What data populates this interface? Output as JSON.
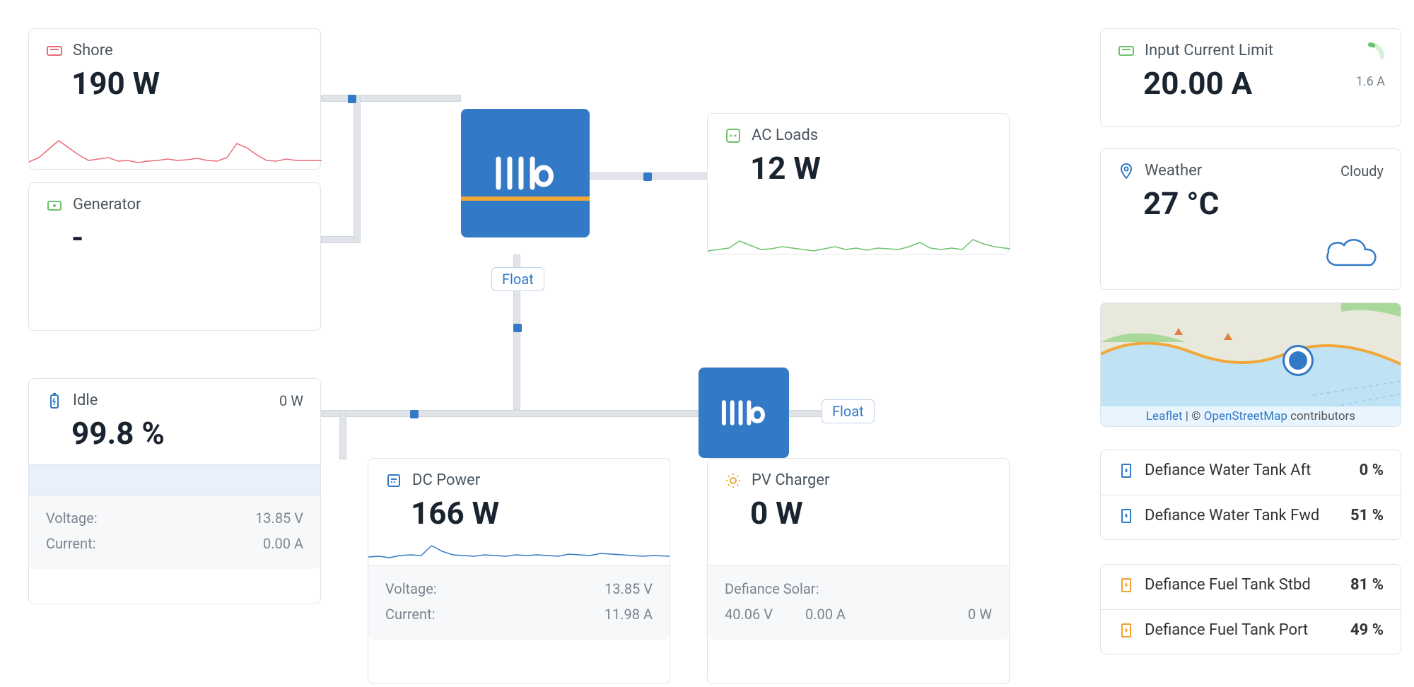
{
  "shore": {
    "label": "Shore",
    "value": "190 W"
  },
  "generator": {
    "label": "Generator",
    "value": "-"
  },
  "acloads": {
    "label": "AC Loads",
    "value": "12 W"
  },
  "battery": {
    "status_label": "Idle",
    "status_value": "0 W",
    "soc": "99.8 %",
    "voltage_label": "Voltage:",
    "voltage_value": "13.85 V",
    "current_label": "Current:",
    "current_value": "0.00 A"
  },
  "dcpower": {
    "label": "DC Power",
    "value": "166 W",
    "voltage_label": "Voltage:",
    "voltage_value": "13.85 V",
    "current_label": "Current:",
    "current_value": "11.98 A"
  },
  "pvcharger": {
    "label": "PV Charger",
    "value": "0 W",
    "array_label": "Defiance Solar:",
    "array_voltage": "40.06 V",
    "array_current": "0.00 A",
    "array_power": "0 W"
  },
  "inverter_status": "Float",
  "mppt_status": "Float",
  "input_limit": {
    "label": "Input Current Limit",
    "value": "20.00 A",
    "gauge_value": "1.6 A"
  },
  "weather": {
    "label": "Weather",
    "condition": "Cloudy",
    "temperature": "27 °C"
  },
  "map": {
    "attribution_leaflet": "Leaflet",
    "attribution_sep": " | © ",
    "attribution_osm": "OpenStreetMap",
    "attribution_suffix": " contributors"
  },
  "tanks": [
    {
      "label": "Defiance Water Tank Aft",
      "value": "0 %",
      "color": "#3279c6"
    },
    {
      "label": "Defiance Water Tank Fwd",
      "value": "51 %",
      "color": "#3279c6"
    },
    {
      "label": "Defiance Fuel Tank Stbd",
      "value": "81 %",
      "color": "#f0a030"
    },
    {
      "label": "Defiance Fuel Tank Port",
      "value": "49 %",
      "color": "#f0a030"
    }
  ],
  "chart_data": [
    {
      "type": "area",
      "series_name": "Shore",
      "ylabel": "W",
      "values": [
        40,
        60,
        80,
        120,
        90,
        70,
        50,
        55,
        60,
        45,
        50,
        40,
        45,
        50,
        55,
        48,
        52,
        58,
        50,
        45,
        60,
        140,
        110,
        70,
        50,
        45,
        55,
        50,
        48
      ],
      "color": "#e86d7a"
    },
    {
      "type": "area",
      "series_name": "AC Loads",
      "ylabel": "W",
      "values": [
        5,
        8,
        12,
        25,
        18,
        8,
        10,
        15,
        12,
        8,
        6,
        10,
        14,
        9,
        11,
        7,
        12,
        10,
        8,
        15,
        22,
        12,
        9,
        11,
        8,
        28,
        20,
        14,
        10
      ],
      "color": "#6ec26e"
    },
    {
      "type": "area",
      "series_name": "DC Power",
      "ylabel": "W",
      "values": [
        150,
        152,
        148,
        155,
        160,
        158,
        190,
        175,
        162,
        158,
        155,
        160,
        158,
        156,
        160,
        158,
        162,
        160,
        158,
        165,
        162,
        160,
        168,
        165,
        162,
        160,
        158,
        160,
        158
      ],
      "color": "#3279c6"
    }
  ]
}
